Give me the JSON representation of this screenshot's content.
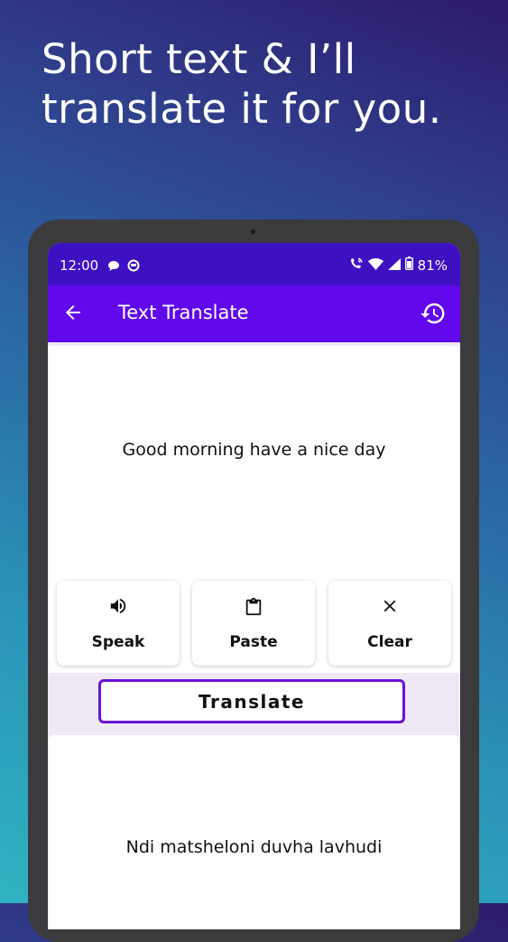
{
  "headline": {
    "line1": "Short text & I’ll",
    "line2": "translate it for you."
  },
  "status_bar": {
    "time": "12:00",
    "battery": "81%",
    "icons": [
      "chat-bubble-icon",
      "circle-notification-icon",
      "wifi-calling-icon",
      "wifi-icon",
      "signal-icon",
      "battery-icon"
    ]
  },
  "app_bar": {
    "title": "Text Translate",
    "back_icon": "arrow-left-icon",
    "history_icon": "history-icon"
  },
  "input": {
    "text": "Good morning have a nice day"
  },
  "actions": [
    {
      "label": "Speak",
      "icon": "speaker-icon"
    },
    {
      "label": "Paste",
      "icon": "clipboard-icon"
    },
    {
      "label": "Clear",
      "icon": "close-icon"
    }
  ],
  "translate_button": {
    "label": "Translate"
  },
  "output": {
    "text": "Ndi matsheloni duvha lavhudi"
  },
  "colors": {
    "status_bar": "#3d10c2",
    "app_bar": "#6208ec",
    "translate_border": "#6a12d2",
    "screen_background": "#efe9f6"
  }
}
